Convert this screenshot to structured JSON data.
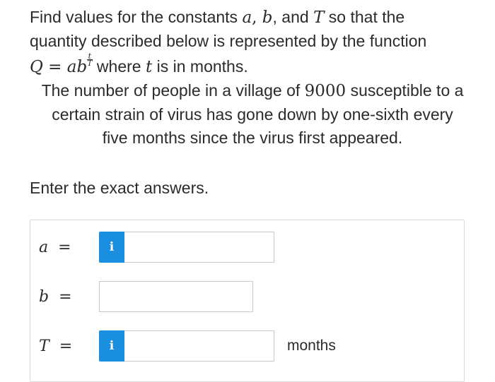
{
  "question": {
    "line1_part1": "Find values for the constants ",
    "var_a": "a",
    "comma1": ", ",
    "var_b": "b",
    "line1_part2": ", and ",
    "var_T": "T",
    "line1_part3": " so that the",
    "line2": "quantity described below is represented by the function",
    "func_Q": "Q",
    "func_eq": " = ",
    "func_ab": "ab",
    "exp_num": "t",
    "exp_den": "T",
    "line3_part1": " where ",
    "var_t": "t",
    "line3_part2": " is in months.",
    "line4_part1": "The number of people in a village of ",
    "village_count": "9000",
    "line4_part2": " susceptible to a",
    "line5": "certain strain of virus has gone down by one-sixth every",
    "line6": "five months since the virus first appeared."
  },
  "instruction": "Enter the exact answers.",
  "answers": {
    "a_label": "a",
    "b_label": "b",
    "T_label": "T",
    "equals": "=",
    "info_glyph": "i",
    "a_value": "",
    "b_value": "",
    "T_value": "",
    "T_unit": "months"
  }
}
